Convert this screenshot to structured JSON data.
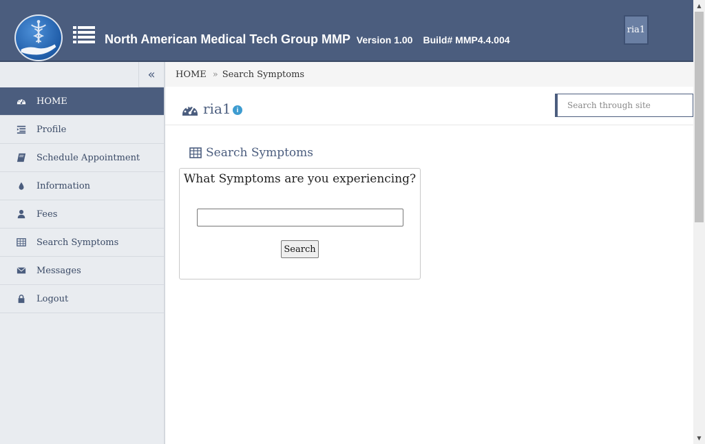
{
  "header": {
    "app_name": "North American Medical Tech Group MMP",
    "version": "Version 1.00",
    "build": "Build# MMP4.4.004",
    "user": "ria1",
    "bg_color": "#4b5d7e"
  },
  "sidebar": {
    "collapse_icon": "double-chevron-left-icon",
    "items": [
      {
        "label": "HOME",
        "icon": "dashboard-icon",
        "active": true
      },
      {
        "label": "Profile",
        "icon": "list-indent-icon",
        "active": false
      },
      {
        "label": "Schedule Appointment",
        "icon": "book-icon",
        "active": false
      },
      {
        "label": "Information",
        "icon": "droplet-icon",
        "active": false
      },
      {
        "label": "Fees",
        "icon": "user-icon",
        "active": false
      },
      {
        "label": "Search Symptoms",
        "icon": "table-icon",
        "active": false
      },
      {
        "label": "Messages",
        "icon": "envelope-icon",
        "active": false
      },
      {
        "label": "Logout",
        "icon": "lock-icon",
        "active": false
      }
    ]
  },
  "breadcrumb": {
    "home": "HOME",
    "separator": "»",
    "current": "Search Symptoms"
  },
  "page": {
    "title": "ria1",
    "search_placeholder": "Search through site"
  },
  "content": {
    "section_title": "Search Symptoms",
    "question": "What Symptoms are you experiencing?",
    "input_value": "",
    "search_label": "Search"
  }
}
